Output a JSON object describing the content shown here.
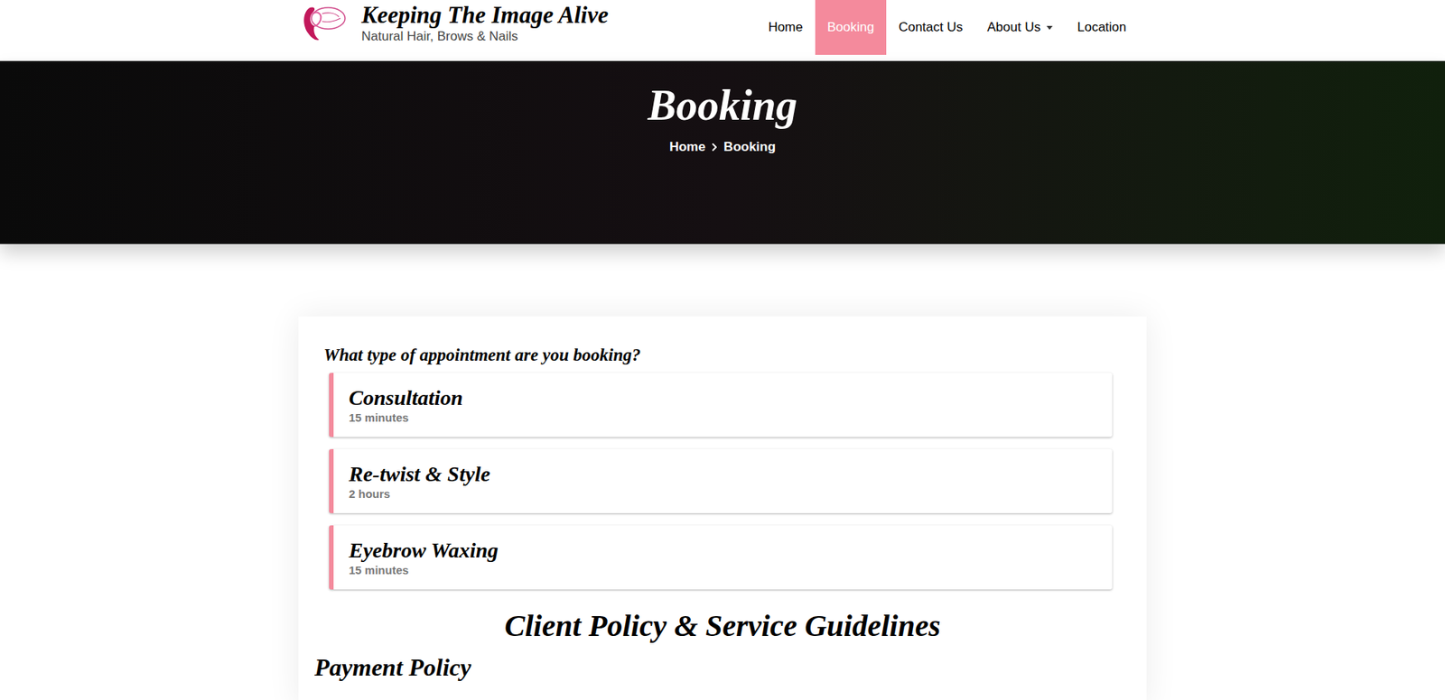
{
  "header": {
    "brand_title": "Keeping The Image Alive",
    "brand_subtitle": "Natural Hair, Brows & Nails"
  },
  "nav": [
    {
      "label": "Home",
      "selected": false,
      "dropdown": false
    },
    {
      "label": "Booking",
      "selected": true,
      "dropdown": false
    },
    {
      "label": "Contact Us",
      "selected": false,
      "dropdown": false
    },
    {
      "label": "About Us",
      "selected": false,
      "dropdown": true
    },
    {
      "label": "Location",
      "selected": false,
      "dropdown": false
    }
  ],
  "hero": {
    "title": "Booking",
    "breadcrumb": [
      "Home",
      "Booking"
    ]
  },
  "booking": {
    "question": "What type of appointment are you booking?",
    "appointments": [
      {
        "name": "Consultation",
        "duration": "15 minutes"
      },
      {
        "name": "Re-twist & Style",
        "duration": "2 hours"
      },
      {
        "name": "Eyebrow Waxing",
        "duration": "15 minutes"
      }
    ]
  },
  "policy": {
    "heading": "Client Policy & Service Guidelines",
    "section": "Payment Policy"
  }
}
